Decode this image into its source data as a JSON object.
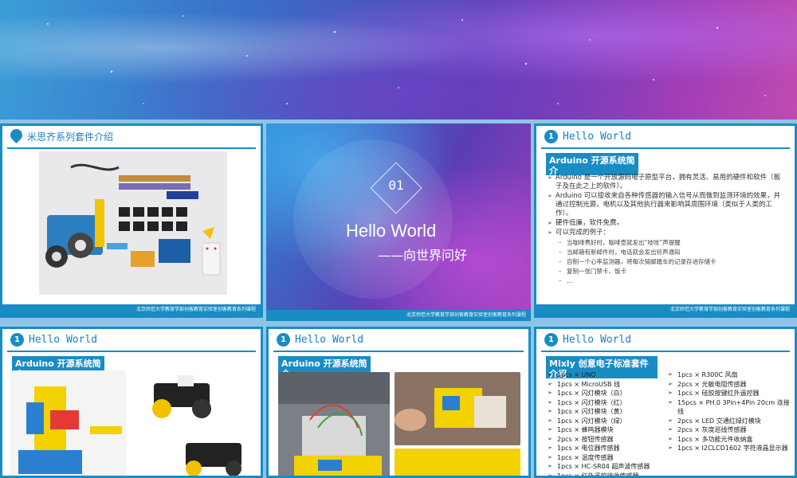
{
  "slides": {
    "s1": {
      "title": "米思齐系列套件介绍",
      "icon": "pin-icon",
      "footer": "北京师范大学教育学部创客教育实验室创客教育系列课程"
    },
    "s2": {
      "number": "01",
      "title": "Hello World",
      "subtitle": "——向世界问好",
      "footer": "北京师范大学教育学部创客教育实验室创客教育系列课程"
    },
    "s3": {
      "badge": "1",
      "title": "Hello World",
      "tag": "Arduino 开源系统简介",
      "bullets": [
        "Arduino 是一个开放源码电子原型平台，拥有灵活、易用的硬件和软件（板子及在此之上的软件）。",
        "Arduino 可以接收来自各种传感器的输入信号从而做到监测环境的效果，并通过控制光源，电机以及其他执行器来影响其周围环境（类似于人类的工作）。",
        "硬件低廉，软件免费。",
        "可以完成的例子："
      ],
      "examples": [
        "当咖啡煮好时，咖啡壶就发出“吱吱”声提醒",
        "当邮箱有新邮件时，电话就会发出铃声通知",
        "自制一个心率监测器，将每次骑脚踏车的记录存进存储卡",
        "复制一张门禁卡、饭卡",
        "…"
      ],
      "footer": "北京师范大学教育学部创客教育实验室创客教育系列课程"
    },
    "s4": {
      "badge": "1",
      "title": "Hello World",
      "tag": "Arduino 开源系统简介"
    },
    "s5": {
      "badge": "1",
      "title": "Hello World",
      "tag": "Arduino 开源系统简介"
    },
    "s6": {
      "badge": "1",
      "title": "Hello World",
      "tag": "Mixly 创意电子标准套件介绍",
      "left": [
        "1pcs × UNO",
        "1pcs × MicroUSB 线",
        "1pcs × 闪灯模块（白）",
        "1pcs × 闪灯模块（红）",
        "1pcs × 闪灯模块（黄）",
        "1pcs × 闪灯模块（绿）",
        "1pcs × 蜂鸣器模块",
        "2pcs × 按钮传感器",
        "1pcs × 电位器传感器",
        "1pcs × 温度传感器",
        "1pcs × HC-SR04 超声波传感器",
        "1pcs × 红外遥控接收传感器"
      ],
      "right": [
        "1pcs × R300C 风扇",
        "2pcs × 光敏电阻传感器",
        "1pcs × 硅胶按键红外遥控器",
        "15pcs × PH.0 3Pin+4Pin 20cm 连接线",
        "2pcs × LED 交通红绿灯模块",
        "2pcs × 灰度巡线传感器",
        "1pcs × 多功能元件收纳盒",
        "1pcs × I2CLCD1602 字符液晶显示器"
      ]
    }
  }
}
